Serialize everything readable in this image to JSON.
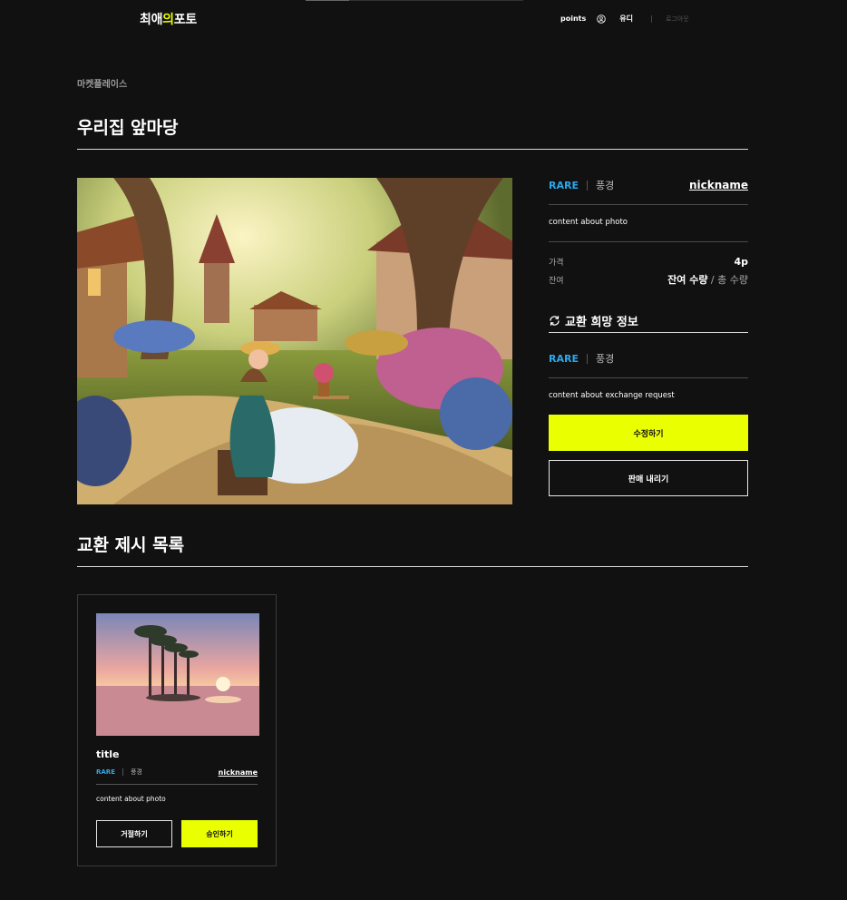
{
  "header": {
    "logo_left": "최애",
    "logo_mid": "의",
    "logo_right": "포토",
    "points_label": "points",
    "user_name": "유디",
    "logout_label": "로그아웃"
  },
  "breadcrumb": "마켓플레이스",
  "page_title": "우리집 앞마당",
  "product": {
    "rarity": "RARE",
    "category": "풍경",
    "nickname": "nickname",
    "description": "content about photo",
    "price_label": "가격",
    "price_value": "4p",
    "stock_label": "잔여",
    "stock_value": "잔여 수량",
    "stock_total": " / 총 수량"
  },
  "exchange": {
    "title": "교환 희망 정보",
    "rarity": "RARE",
    "category": "풍경",
    "description": "content about exchange request"
  },
  "buttons": {
    "edit": "수정하기",
    "unlist": "판매 내리기"
  },
  "offers_section_title": "교환 제시 목록",
  "offers": [
    {
      "title": "title",
      "rarity": "RARE",
      "category": "풍경",
      "nickname": "nickname",
      "description": "content about photo",
      "reject_label": "거절하기",
      "approve_label": "승인하기"
    }
  ],
  "colors": {
    "background": "#111111",
    "accent_yellow": "#eaff00",
    "rare_blue": "#2aa8ec"
  },
  "icons": [
    "user-icon",
    "refresh-icon"
  ]
}
